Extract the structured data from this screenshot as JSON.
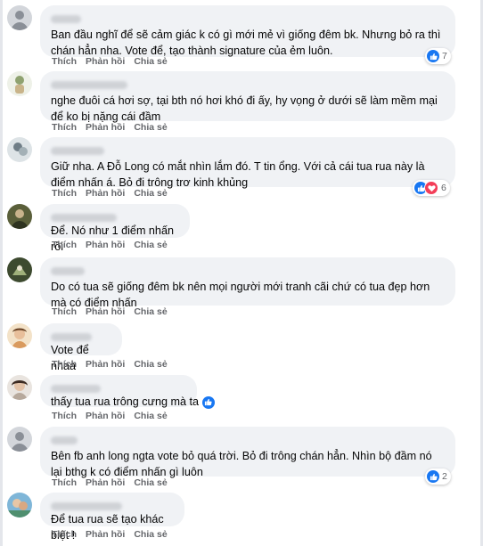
{
  "actions": {
    "like": "Thích",
    "reply": "Phản hồi",
    "share": "Chia sẻ"
  },
  "colors": {
    "like_blue": "#1877f2",
    "love_red": "#f33e58",
    "bubble_bg": "#f0f2f5",
    "meta_gray": "#65676b"
  },
  "icons": {
    "like": "thumbs-up-icon",
    "love": "heart-icon"
  },
  "comments": [
    {
      "text": "Ban đầu nghĩ để sẽ cảm giác k có gì mới mẻ vì giống đêm bk. Nhưng bỏ ra thì chán hẳn nha. Vote để, tạo thành signature của ẻm luôn.",
      "reaction_count": "7"
    },
    {
      "text": "nghe đuôi cá hơi sợ, tại bth nó hơi khó đi ấy, hy vọng ở dưới sẽ làm mềm mại để ko bị nặng cái đầm"
    },
    {
      "text": "Giữ nha. A Đỗ Long có mắt nhìn lắm đó. T tin ổng. Với cả cái tua rua này là điểm nhấn á. Bỏ đi trông trơ kinh khủng",
      "reaction_count": "6"
    },
    {
      "text": "Để. Nó như 1 điểm nhấn rồi"
    },
    {
      "text": "Do có tua sẽ giống đêm bk nên mọi người mới tranh cãi chứ có tua đẹp hơn mà có điểm nhấn"
    },
    {
      "text": "Vote để nhaa"
    },
    {
      "text": "thấy tua rua trông cưng mà ta"
    },
    {
      "text": "Bên fb anh long ngta vote bỏ quá trời. Bỏ đi trông chán hẳn. Nhìn bộ đầm nó lại bthg k có điểm nhấn gì luôn",
      "reaction_count": "2"
    },
    {
      "text": "Để tua rua sẽ tạo khác biệt !"
    }
  ]
}
